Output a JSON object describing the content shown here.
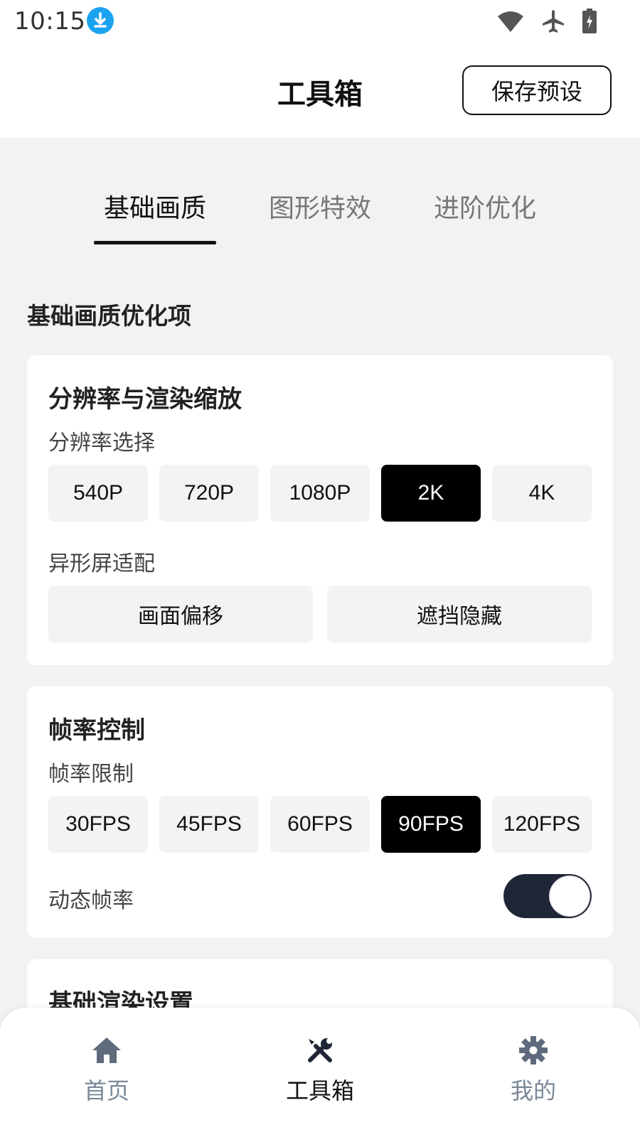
{
  "status_bar": {
    "time": "10:15"
  },
  "header": {
    "title": "工具箱",
    "save_preset": "保存预设"
  },
  "tabs": [
    {
      "label": "基础画质",
      "active": true
    },
    {
      "label": "图形特效",
      "active": false
    },
    {
      "label": "进阶优化",
      "active": false
    }
  ],
  "section_title": "基础画质优化项",
  "resolution_card": {
    "title": "分辨率与渲染缩放",
    "resolution_label": "分辨率选择",
    "resolutions": [
      "540P",
      "720P",
      "1080P",
      "2K",
      "4K"
    ],
    "resolution_selected": "2K",
    "notch_label": "异形屏适配",
    "notch_options": [
      "画面偏移",
      "遮挡隐藏"
    ]
  },
  "framerate_card": {
    "title": "帧率控制",
    "limit_label": "帧率限制",
    "fps_options": [
      "30FPS",
      "45FPS",
      "60FPS",
      "90FPS",
      "120FPS"
    ],
    "fps_selected": "90FPS",
    "dynamic_label": "动态帧率",
    "dynamic_enabled": true
  },
  "render_card": {
    "title": "基础渲染设置"
  },
  "bottom_nav": [
    {
      "label": "首页",
      "icon": "home-icon",
      "active": false
    },
    {
      "label": "工具箱",
      "icon": "tools-icon",
      "active": true
    },
    {
      "label": "我的",
      "icon": "gear-icon",
      "active": false
    }
  ],
  "colors": {
    "accent": "#000000",
    "toggle_on": "#1f2736",
    "download_badge": "#1aa3f0",
    "nav_inactive": "#7a889a"
  }
}
